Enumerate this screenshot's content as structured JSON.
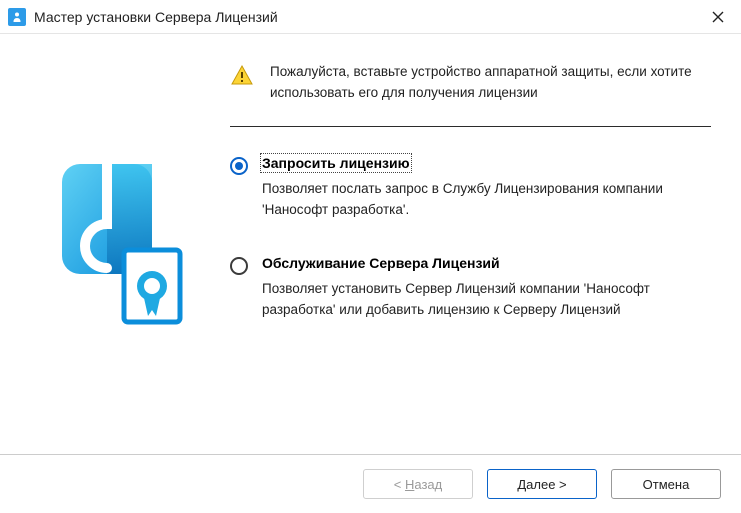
{
  "titlebar": {
    "title": "Мастер установки Сервера Лицензий"
  },
  "notice": {
    "text": "Пожалуйста, вставьте устройство аппаратной защиты, если хотите использовать его для получения лицензии"
  },
  "options": {
    "request": {
      "title": "Запросить лицензию",
      "desc": "Позволяет послать запрос в Службу Лицензирования компании 'Нанософт разработка'.",
      "selected": true
    },
    "maintain": {
      "title": "Обслуживание Сервера Лицензий",
      "desc": "Позволяет установить Сервер Лицензий компании 'Нанософт разработка' или добавить лицензию к Серверу Лицензий",
      "selected": false
    }
  },
  "buttons": {
    "back_prefix": "< ",
    "back_mnemonic": "Н",
    "back_rest": "азад",
    "next_mnemonic": "Д",
    "next_rest": "алее >",
    "cancel": "Отмена"
  }
}
